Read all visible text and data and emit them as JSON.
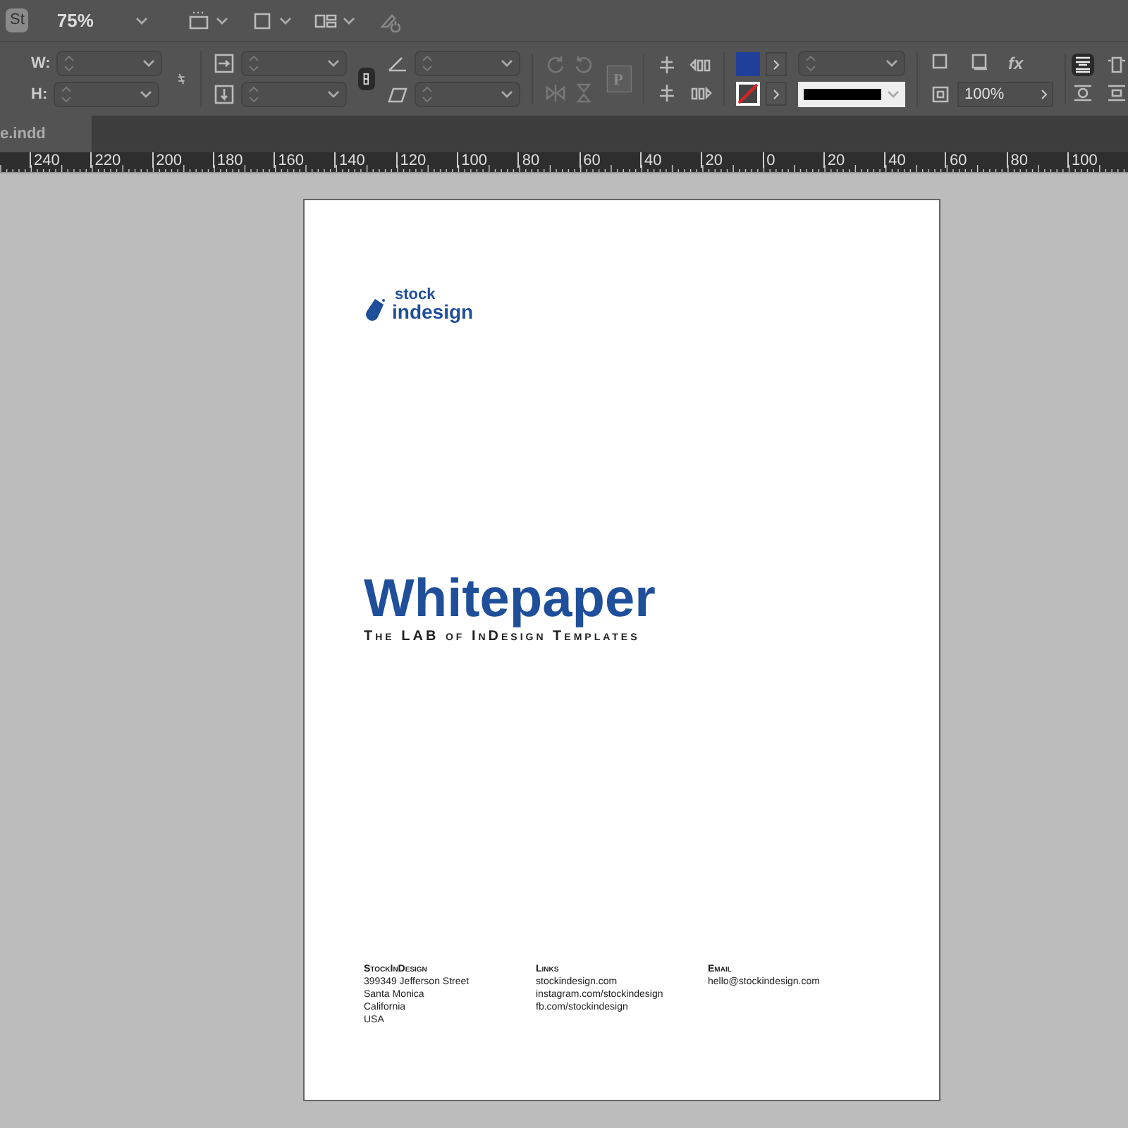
{
  "app_bar": {
    "badge": "St",
    "zoom": "75%"
  },
  "control_panel": {
    "width_label": "W:",
    "height_label": "H:",
    "opacity": "100%",
    "reference_glyph": "P",
    "effects_glyph": "fx"
  },
  "document_tab": {
    "title": "e.indd",
    "selected": true
  },
  "ruler": {
    "labels": [
      "240",
      "220",
      "200",
      "180",
      "160",
      "140",
      "120",
      "100",
      "80",
      "60",
      "40",
      "20",
      "0",
      "20",
      "40",
      "60",
      "80",
      "100"
    ]
  },
  "page": {
    "logo": {
      "top": "stock",
      "bottom": "indesign"
    },
    "title": "Whitepaper",
    "subtitle": "The LAB of InDesign Templates",
    "footer": [
      {
        "heading": "StockInDesign",
        "lines": [
          "399349 Jefferson Street",
          "Santa Monica",
          "California",
          "USA"
        ]
      },
      {
        "heading": "Links",
        "lines": [
          "stockindesign.com",
          "instagram.com/stockindesign",
          "fb.com/stockindesign"
        ]
      },
      {
        "heading": "Email",
        "lines": [
          "hello@stockindesign.com"
        ]
      }
    ]
  }
}
